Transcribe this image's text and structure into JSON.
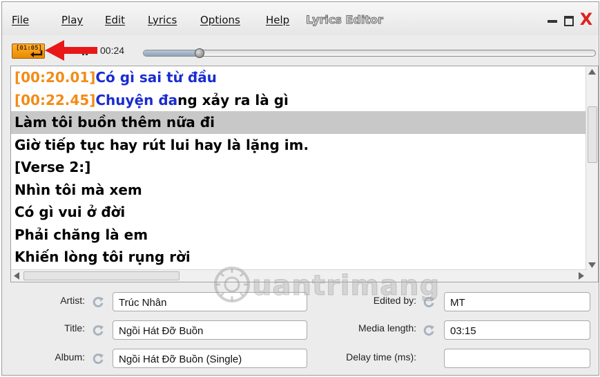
{
  "app": {
    "title": "Lyrics Editor"
  },
  "menu": [
    {
      "label": "File"
    },
    {
      "label": "Play"
    },
    {
      "label": "Edit"
    },
    {
      "label": "Lyrics"
    },
    {
      "label": "Options"
    },
    {
      "label": "Help"
    }
  ],
  "window_controls": {
    "close_glyph": "X"
  },
  "player": {
    "timestamp_button": "[01:05]",
    "elapsed": "00:24",
    "duration": "03:15",
    "progress": 0.1231
  },
  "lyrics": [
    {
      "timestamp": "[00:20.01]",
      "timed_text": "Có gì sai từ đầu",
      "text": ""
    },
    {
      "timestamp": "[00:22.45]",
      "timed_text": "Chuyện đa",
      "text": "ng xảy ra là gì"
    },
    {
      "timestamp": "",
      "timed_text": "",
      "text": "Làm tôi buồn thêm nữa đi"
    },
    {
      "timestamp": "",
      "timed_text": "",
      "text": "Giờ tiếp tục hay rút lui hay là lặng im."
    },
    {
      "timestamp": "",
      "timed_text": "",
      "text": "[Verse 2:]"
    },
    {
      "timestamp": "",
      "timed_text": "",
      "text": "Nhìn tôi mà xem"
    },
    {
      "timestamp": "",
      "timed_text": "",
      "text": "Có gì vui ở đời"
    },
    {
      "timestamp": "",
      "timed_text": "",
      "text": "Phải chăng là em"
    },
    {
      "timestamp": "",
      "timed_text": "",
      "text": "Khiến lòng tôi rụng rời"
    }
  ],
  "selected_line": 2,
  "tags": {
    "artist_label": "Artist:",
    "artist": "Trúc Nhân",
    "title_label": "Title:",
    "title": "Ngồi Hát Đỡ Buồn",
    "album_label": "Album:",
    "album": "Ngồi Hát Đỡ Buồn (Single)",
    "edited_by_label": "Edited by:",
    "edited_by": "MT",
    "media_length_label": "Media length:",
    "media_length": "03:15",
    "delay_label": "Delay time (ms):",
    "delay": ""
  },
  "watermark": "uantrimang",
  "colors": {
    "timestamp": "#f28c18",
    "timed_text": "#1a2ccf",
    "selection": "#c8c8c8",
    "close": "#e02020",
    "annotation_arrow": "#e81818"
  },
  "icons": [
    "enter-icon",
    "pause-icon",
    "sync-icon",
    "minimize-icon",
    "maximize-icon",
    "close-icon",
    "annotation-arrow"
  ]
}
